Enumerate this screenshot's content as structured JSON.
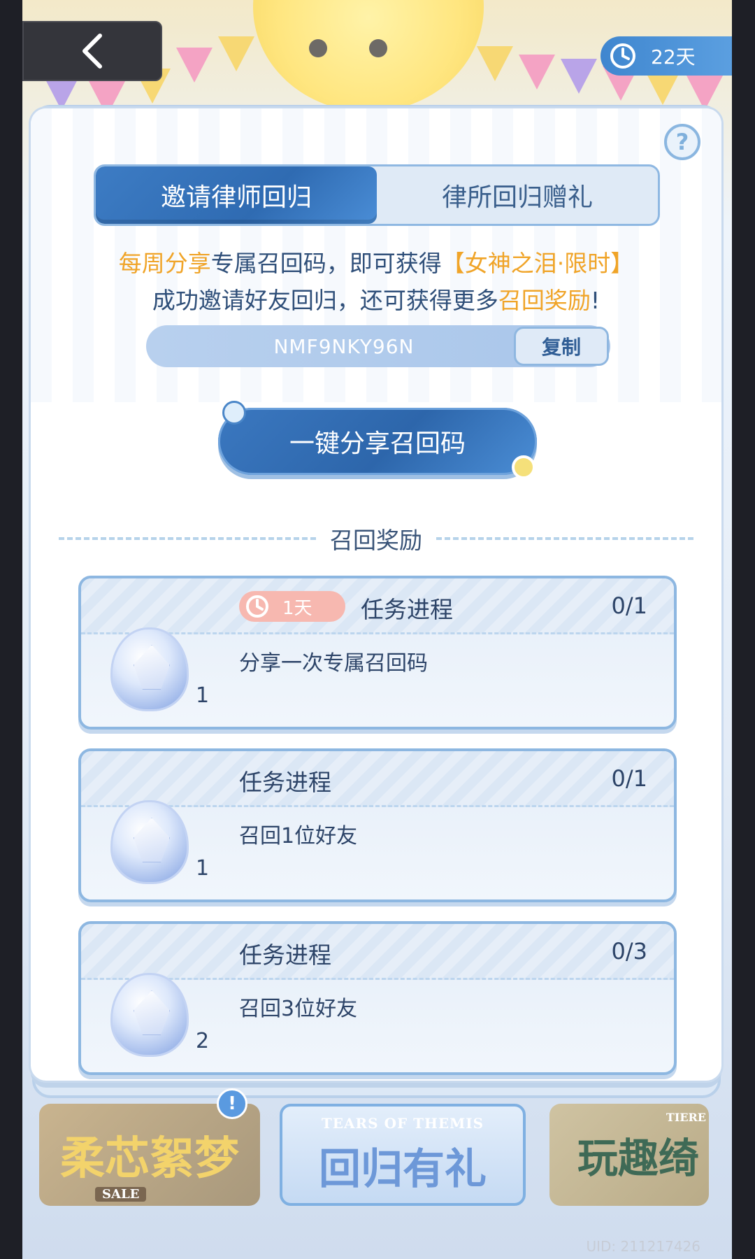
{
  "header": {
    "timer_label": "22天"
  },
  "tabs": [
    {
      "label": "邀请律师回归",
      "active": true
    },
    {
      "label": "律所回归赠礼",
      "active": false
    }
  ],
  "description": {
    "line1_part1": "每周分享",
    "line1_part2": "专属召回码，即可获得",
    "line1_part3": "【女神之泪·限时】",
    "line2_part1": "成功邀请好友回归，还可获得更多",
    "line2_part2": "召回奖励",
    "line2_part3": "!"
  },
  "recall_code": {
    "code": "NMF9NKY96N",
    "copy_label": "复制"
  },
  "share_button": {
    "label": "一键分享召回码"
  },
  "rewards_section": {
    "title": "召回奖励"
  },
  "tasks": [
    {
      "timer": "1天",
      "title": "任务进程",
      "progress": "0/1",
      "description": "分享一次专属召回码",
      "reward_count": "1"
    },
    {
      "title": "任务进程",
      "progress": "0/1",
      "description": "召回1位好友",
      "reward_count": "1"
    },
    {
      "title": "任务进程",
      "progress": "0/3",
      "description": "召回3位好友",
      "reward_count": "2"
    }
  ],
  "bottom_banners": [
    {
      "label": "柔芯絮梦",
      "sub": "SALE"
    },
    {
      "label": "回归有礼",
      "sub": "TEARS OF THEMIS"
    },
    {
      "label": "玩趣绮",
      "sub": "TIERE"
    }
  ],
  "footer": {
    "uid": "UID: 211217426"
  },
  "colors": {
    "accent_blue": "#2f6bb2",
    "highlight_orange": "#f0a428",
    "text_dark": "#2d4468"
  }
}
